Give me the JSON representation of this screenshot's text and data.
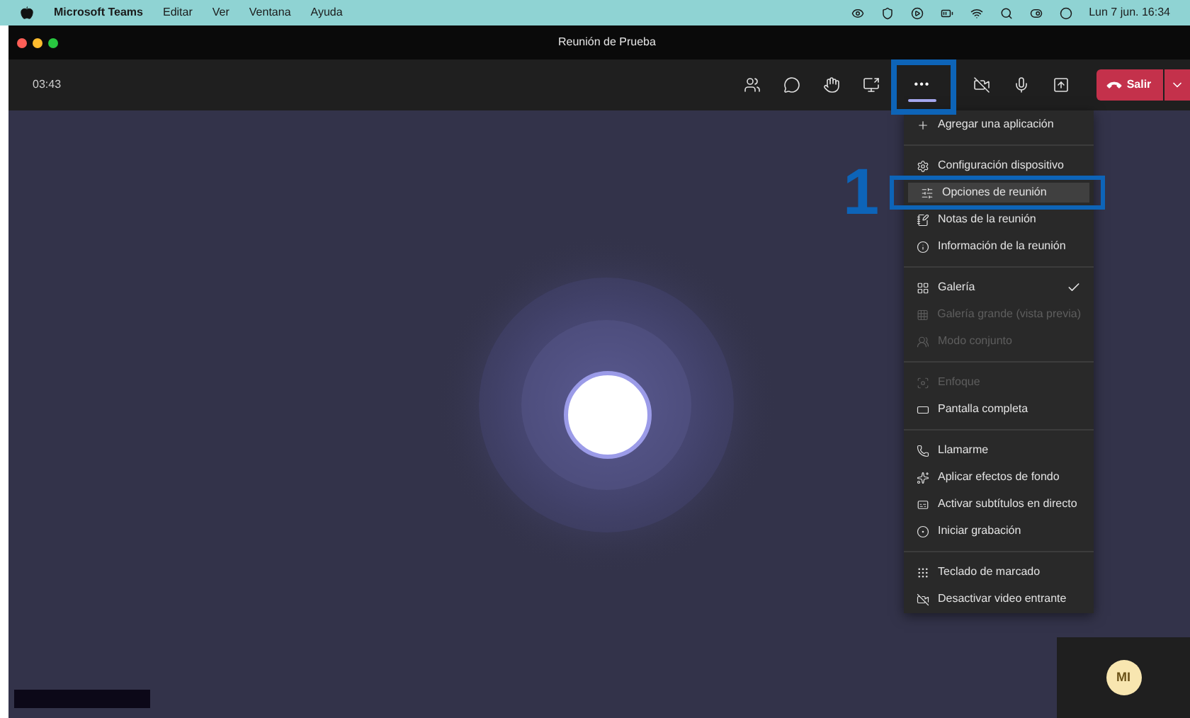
{
  "menu_bar": {
    "app": "Microsoft Teams",
    "items": [
      "Editar",
      "Ver",
      "Ventana",
      "Ayuda"
    ],
    "clock": "Lun 7 jun. 16:34"
  },
  "window": {
    "title": "Reunión de Prueba"
  },
  "toolbar": {
    "timer": "03:43",
    "buttons": [
      {
        "kind": "people",
        "selected": false
      },
      {
        "kind": "chat",
        "selected": false
      },
      {
        "kind": "hand",
        "selected": false
      },
      {
        "kind": "share",
        "selected": false
      },
      {
        "kind": "more",
        "label": "•••",
        "selected": true
      },
      {
        "kind": "camera-off",
        "selected": false
      },
      {
        "kind": "mic",
        "selected": false
      },
      {
        "kind": "tray",
        "selected": false
      }
    ],
    "leave": {
      "label": "Salir"
    }
  },
  "menu": [
    [
      {
        "label": "Agregar una aplicación",
        "disabled": false,
        "checked": false,
        "selected": false
      }
    ],
    [
      {
        "label": "Configuración dispositivo",
        "disabled": false,
        "checked": false,
        "selected": false
      },
      {
        "label": "Opciones de reunión",
        "disabled": false,
        "checked": false,
        "selected": true
      },
      {
        "label": "Notas de la reunión",
        "disabled": false,
        "checked": false,
        "selected": false
      },
      {
        "label": "Información de la reunión",
        "disabled": false,
        "checked": false,
        "selected": false
      }
    ],
    [
      {
        "label": "Galería",
        "disabled": false,
        "checked": true,
        "selected": false
      },
      {
        "label": "Galería grande (vista previa)",
        "disabled": true,
        "checked": false,
        "selected": false
      },
      {
        "label": "Modo conjunto",
        "disabled": true,
        "checked": false,
        "selected": false
      }
    ],
    [
      {
        "label": "Enfoque",
        "disabled": true,
        "checked": false,
        "selected": false
      },
      {
        "label": "Pantalla completa",
        "disabled": false,
        "checked": false,
        "selected": false
      }
    ],
    [
      {
        "label": "Llamarme",
        "disabled": false,
        "checked": false,
        "selected": false
      },
      {
        "label": "Aplicar efectos de fondo",
        "disabled": false,
        "checked": false,
        "selected": false
      },
      {
        "label": "Activar subtítulos en directo",
        "disabled": false,
        "checked": false,
        "selected": false
      },
      {
        "label": "Iniciar grabación",
        "disabled": false,
        "checked": false,
        "selected": false
      }
    ],
    [
      {
        "label": "Teclado de marcado",
        "disabled": false,
        "checked": false,
        "selected": false
      },
      {
        "label": "Desactivar video entrante",
        "disabled": false,
        "checked": false,
        "selected": false
      }
    ]
  ],
  "annotation": {
    "label": "1"
  },
  "self_view": {
    "initials": "MI"
  }
}
